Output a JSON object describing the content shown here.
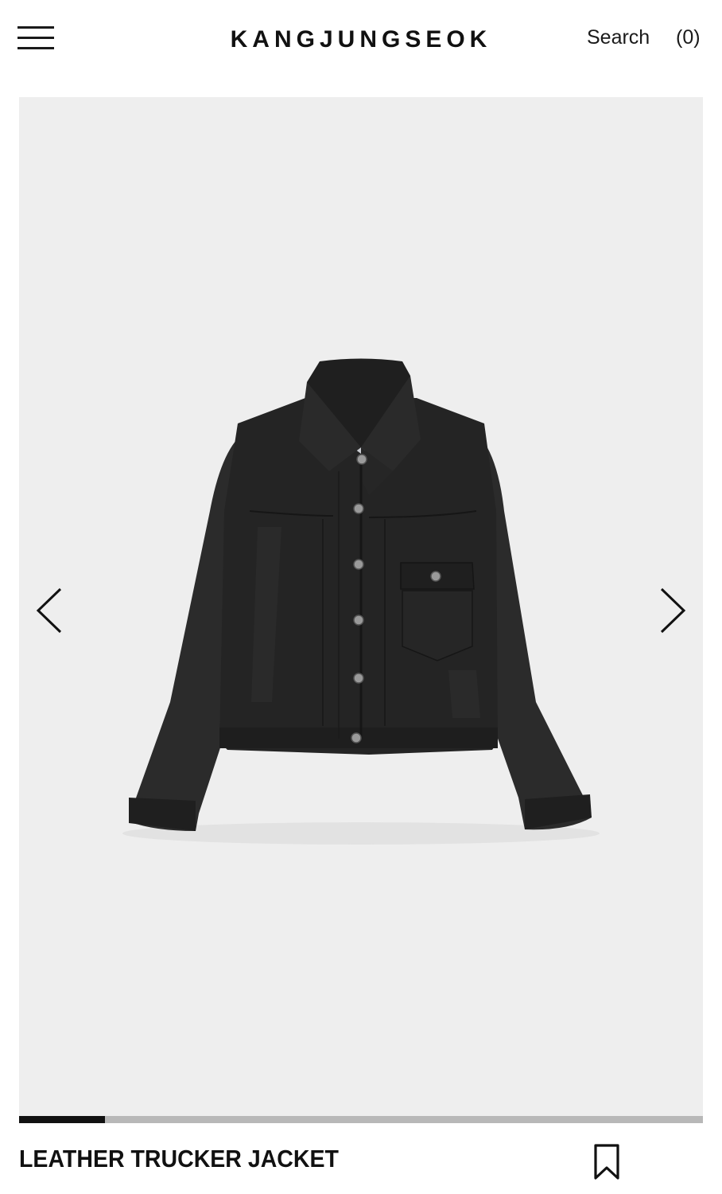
{
  "header": {
    "brand": "KANGJUNGSEOK",
    "search_label": "Search",
    "cart_label": "(0)"
  },
  "gallery": {
    "image_subject": "black leather trucker jacket",
    "progress_fraction": 0.125,
    "prev_icon": "chevron-left-icon",
    "next_icon": "chevron-right-icon"
  },
  "product": {
    "name": "LEATHER TRUCKER JACKET",
    "bookmark_icon": "bookmark-icon"
  },
  "colors": {
    "background": "#ffffff",
    "gallery_bg": "#eeeeee",
    "text": "#111111",
    "progress_track": "#b8b8b8",
    "progress_fill": "#111111"
  }
}
